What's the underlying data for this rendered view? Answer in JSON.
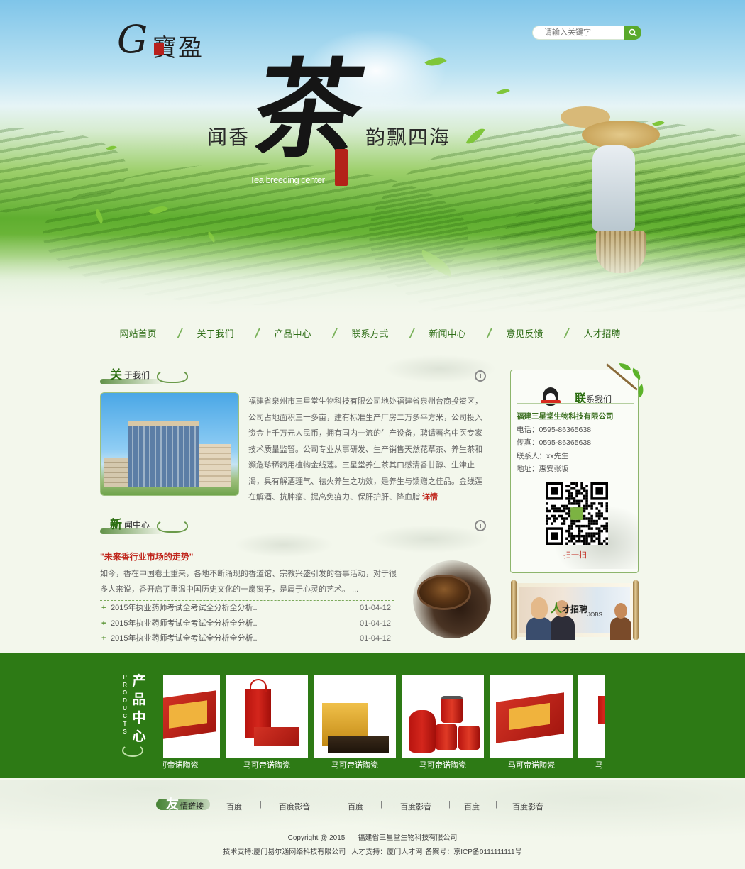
{
  "logo": {
    "mark": "G",
    "name": "寶盈"
  },
  "search": {
    "placeholder": "请输入关键字"
  },
  "hero": {
    "slogan_left": "闻香",
    "slogan_main": "茶",
    "slogan_right": "韵飘四海",
    "slogan_en": "Tea breeding center"
  },
  "nav": {
    "items": [
      "网站首页",
      "关于我们",
      "产品中心",
      "联系方式",
      "新闻中心",
      "意见反馈",
      "人才招聘"
    ]
  },
  "about": {
    "title_big": "关",
    "title_small": "于我们",
    "text": "福建省泉州市三星堂生物科技有限公司地处福建省泉州台商投资区，公司占地面积三十多亩，建有标准生产厂房二万多平方米，公司投入资金上千万元人民币，拥有国内一流的生产设备，聘请著名中医专家技术质量监管。公司专业从事研发、生产销售天然花草茶、养生茶和濒危珍稀药用植物金线莲。三星堂养生茶其口感清香甘醇、生津止渴，具有解酒理气、祛火养生之功效，是养生与馈赠之佳品。金线莲在解酒、抗肿瘤、提高免疫力、保肝护肝、降血脂 ",
    "detail": "详情"
  },
  "news": {
    "title_big": "新",
    "title_small": "闻中心",
    "headline": "\"未来香行业市场的走势\"",
    "summary": "如今，香在中国卷土重来，各地不断涌现的香道馆、宗教兴盛引发的香事活动，对于很多人来说，香开启了重温中国历史文化的一扇窗子，是属于心灵的艺术。 ...",
    "items": [
      {
        "title": "2015年执业药师考试全考试全分析全分析..",
        "date": "01-04-12"
      },
      {
        "title": "2015年执业药师考试全考试全分析全分析..",
        "date": "01-04-12"
      },
      {
        "title": "2015年执业药师考试全考试全分析全分析..",
        "date": "01-04-12"
      }
    ]
  },
  "contact": {
    "title_big": "联",
    "title_small": "系我们",
    "company": "福建三星堂生物科技有限公司",
    "phone": "电话：0595-86365638",
    "fax": "传真：0595-86365638",
    "person": "联系人：xx先生",
    "address": "地址：惠安张坂",
    "scan": "扫一扫"
  },
  "jobs": {
    "title_big": "人",
    "title_small": "才招聘",
    "en": "JOBS"
  },
  "products": {
    "label_cn": [
      "产",
      "品",
      "中",
      "心"
    ],
    "label_en": [
      "P",
      "R",
      "O",
      "D",
      "U",
      "C",
      "T",
      "S"
    ],
    "items": [
      {
        "caption": "可帝诺陶瓷"
      },
      {
        "caption": "马可帝诺陶瓷"
      },
      {
        "caption": "马可帝诺陶瓷"
      },
      {
        "caption": "马可帝诺陶瓷"
      },
      {
        "caption": "马可帝诺陶瓷"
      },
      {
        "caption": "马"
      }
    ]
  },
  "friends": {
    "title_big": "友",
    "title_small": "情链接",
    "links": [
      "百度",
      "百度影音",
      "百度",
      "百度影音",
      "百度",
      "百度影音"
    ]
  },
  "footer": {
    "copyright": "Copyright @ 2015",
    "company": "福建省三星堂生物科技有限公司",
    "tech": "技术支持:厦门易尔通网络科技有限公司",
    "talent": "人才支持：厦门人才网",
    "icp": "备案号：京ICP备0111111111号"
  },
  "colors": {
    "brand_green": "#2d7a15",
    "accent_red": "#c0261c"
  }
}
